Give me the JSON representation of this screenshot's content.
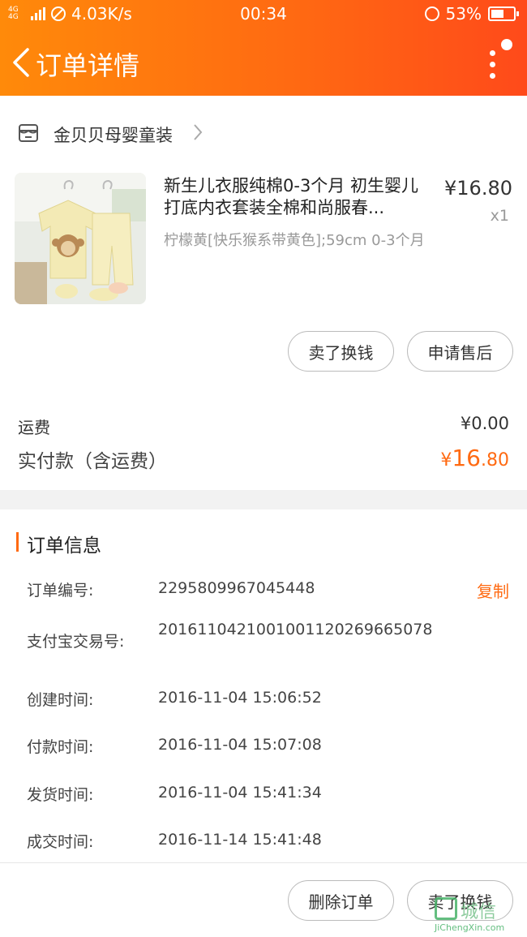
{
  "status_bar": {
    "network": "4G 4G",
    "speed": "4.03K/s",
    "time": "00:34",
    "battery": "53%"
  },
  "header": {
    "title": "订单详情",
    "back_icon": "chevron-left-icon",
    "menu_icon": "more-vertical-icon"
  },
  "shop": {
    "name": "金贝贝母婴童装",
    "icon": "store-icon"
  },
  "product": {
    "title": "新生儿衣服纯棉0-3个月 初生婴儿打底内衣套装全棉和尚服春...",
    "price": "¥16.80",
    "quantity": "x1",
    "spec": "柠檬黄[快乐猴系带黄色];59cm 0-3个月"
  },
  "item_actions": {
    "sell_label": "卖了换钱",
    "after_sale_label": "申请售后"
  },
  "totals": {
    "shipping_label": "运费",
    "shipping_value": "¥0.00",
    "paid_label": "实付款（含运费）",
    "paid_currency": "¥",
    "paid_integer": "16",
    "paid_decimal": ".80"
  },
  "order_info": {
    "section_title": "订单信息",
    "copy_label": "复制",
    "rows": [
      {
        "label": "订单编号:",
        "value": "2295809967045448"
      },
      {
        "label": "支付宝交易号:",
        "value": "2016110421001001120269665078"
      },
      {
        "label": "创建时间:",
        "value": "2016-11-04 15:06:52"
      },
      {
        "label": "付款时间:",
        "value": "2016-11-04 15:07:08"
      },
      {
        "label": "发货时间:",
        "value": "2016-11-04 15:41:34"
      },
      {
        "label": "成交时间:",
        "value": "2016-11-14 15:41:48"
      }
    ]
  },
  "bottom_actions": {
    "delete_label": "删除订单",
    "sell_label": "卖了换钱"
  },
  "watermark": {
    "text": "城信",
    "url": "JiChengXin.com"
  },
  "colors": {
    "accent": "#ff6a12",
    "header_start": "#ff8a0a",
    "header_end": "#ff4a1a"
  }
}
